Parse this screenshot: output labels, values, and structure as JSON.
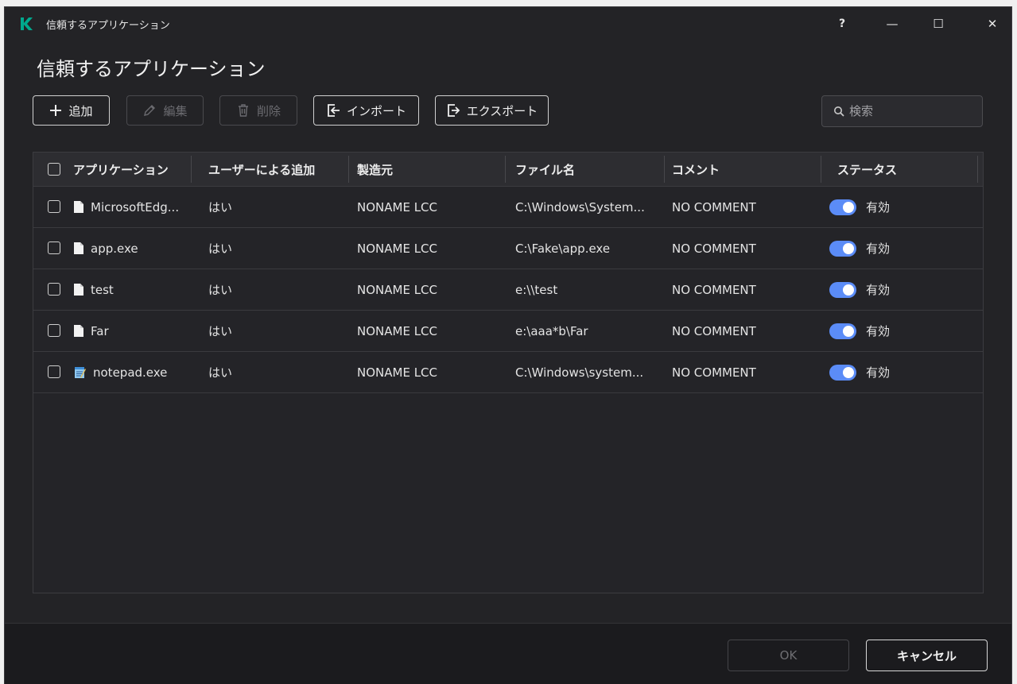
{
  "window": {
    "title": "信頼するアプリケーション",
    "help_label": "?",
    "minimize_label": "—",
    "maximize_label": "☐",
    "close_label": "✕"
  },
  "page": {
    "title": "信頼するアプリケーション"
  },
  "toolbar": {
    "add_label": "追加",
    "edit_label": "編集",
    "delete_label": "削除",
    "import_label": "インポート",
    "export_label": "エクスポート"
  },
  "search": {
    "placeholder": "検索",
    "value": ""
  },
  "table": {
    "columns": [
      "アプリケーション",
      "ユーザーによる追加",
      "製造元",
      "ファイル名",
      "コメント",
      "ステータス"
    ],
    "rows": [
      {
        "app": "MicrosoftEdg...",
        "icon": "file-icon",
        "user_added": "はい",
        "vendor": "NONAME LCC",
        "file": "C:\\Windows\\System...",
        "comment": "NO COMMENT",
        "status": "有効",
        "enabled": true
      },
      {
        "app": "app.exe",
        "icon": "file-icon",
        "user_added": "はい",
        "vendor": "NONAME LCC",
        "file": "C:\\Fake\\app.exe",
        "comment": "NO COMMENT",
        "status": "有効",
        "enabled": true
      },
      {
        "app": "test",
        "icon": "file-icon",
        "user_added": "はい",
        "vendor": "NONAME LCC",
        "file": "e:\\\\test",
        "comment": "NO COMMENT",
        "status": "有効",
        "enabled": true
      },
      {
        "app": "Far",
        "icon": "file-icon",
        "user_added": "はい",
        "vendor": "NONAME LCC",
        "file": "e:\\aaa*b\\Far",
        "comment": "NO COMMENT",
        "status": "有効",
        "enabled": true
      },
      {
        "app": "notepad.exe",
        "icon": "notepad-icon",
        "user_added": "はい",
        "vendor": "NONAME LCC",
        "file": "C:\\Windows\\system...",
        "comment": "NO COMMENT",
        "status": "有効",
        "enabled": true
      }
    ]
  },
  "footer": {
    "ok_label": "OK",
    "cancel_label": "キャンセル"
  },
  "colors": {
    "accent": "#5b8cf7",
    "brand": "#00a88e",
    "background": "#232326"
  }
}
